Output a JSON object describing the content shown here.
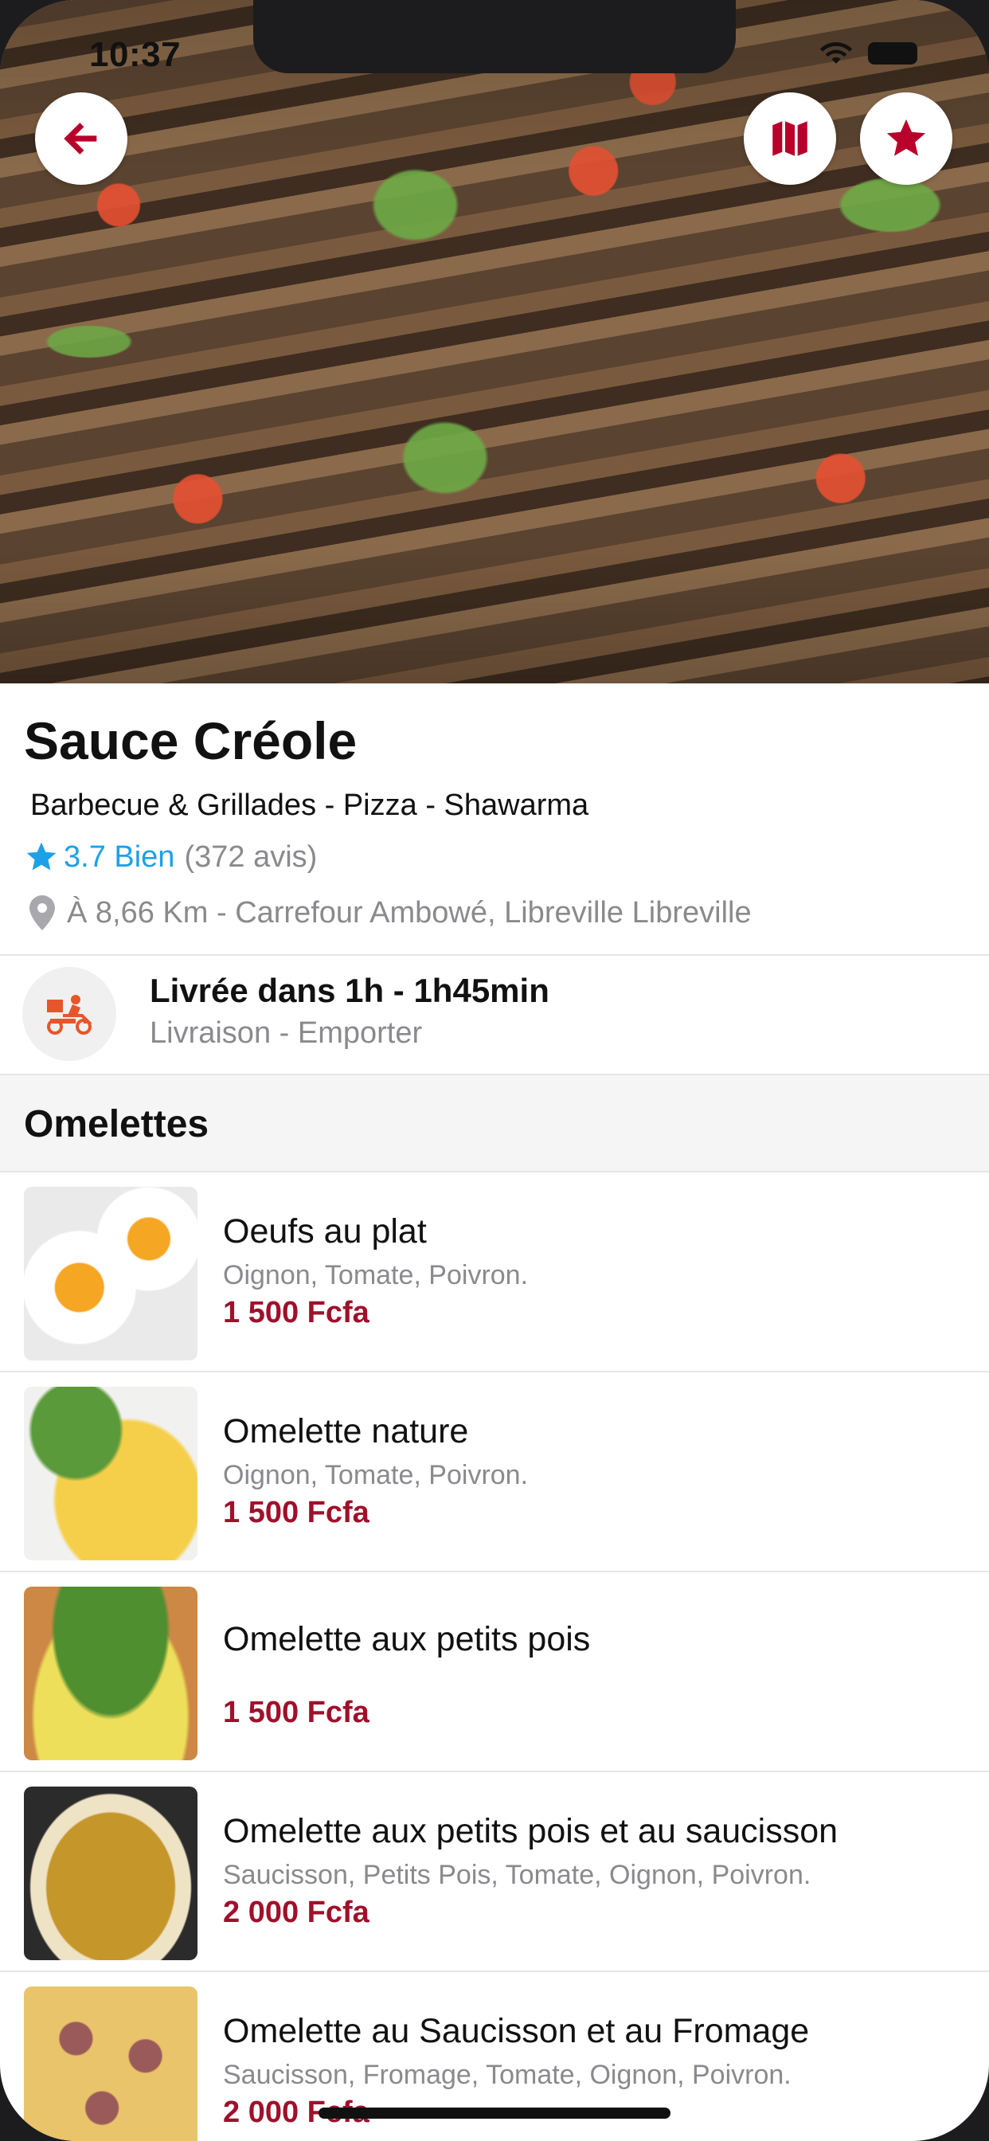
{
  "status_bar": {
    "time": "10:37"
  },
  "restaurant": {
    "name": "Sauce Créole",
    "categories": "Barbecue & Grillades - Pizza - Shawarma",
    "rating_score": "3.7 Bien",
    "rating_count": "(372 avis)",
    "address": "À 8,66 Km - Carrefour Ambowé,  Libreville Libreville"
  },
  "delivery": {
    "title": "Livrée dans 1h - 1h45min",
    "modes": "Livraison - Emporter"
  },
  "section": {
    "title": "Omelettes"
  },
  "items": [
    {
      "name": "Oeufs au plat",
      "desc": "Oignon, Tomate, Poivron.",
      "price": "1 500 Fcfa"
    },
    {
      "name": "Omelette nature",
      "desc": "Oignon, Tomate, Poivron.",
      "price": "1 500 Fcfa"
    },
    {
      "name": "Omelette aux petits pois",
      "desc": "",
      "price": "1 500 Fcfa"
    },
    {
      "name": "Omelette aux petits pois et au saucisson",
      "desc": "Saucisson, Petits Pois, Tomate, Oignon, Poivron.",
      "price": "2 000 Fcfa"
    },
    {
      "name": "Omelette au Saucisson et au Fromage",
      "desc": "Saucisson, Fromage, Tomate, Oignon, Poivron.",
      "price": "2 000 Fcfa"
    }
  ],
  "colors": {
    "accent": "#b8002a",
    "price": "#a0102a",
    "rating": "#1da1e6"
  },
  "icons": [
    "back-arrow-icon",
    "map-icon",
    "star-icon",
    "location-pin-icon",
    "delivery-scooter-icon"
  ]
}
